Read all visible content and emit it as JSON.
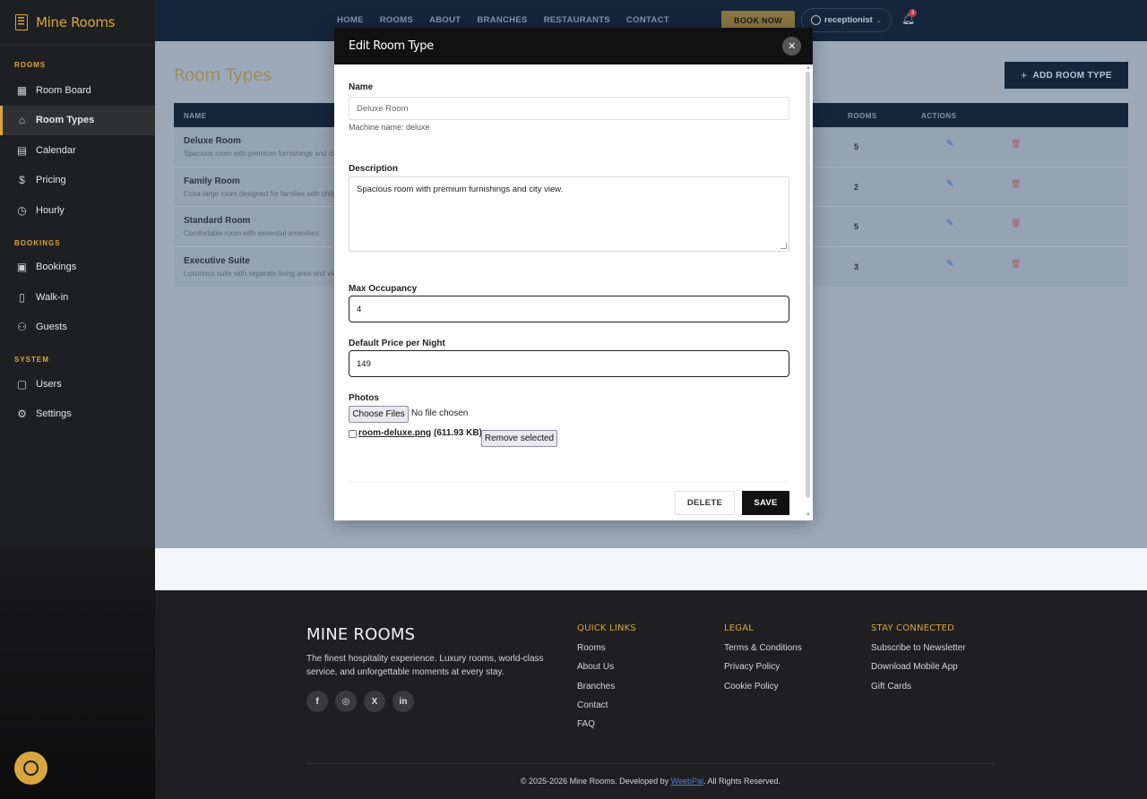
{
  "brand": {
    "name": "Mine Rooms"
  },
  "sidebar": {
    "sections": [
      {
        "title": "ROOMS",
        "items": [
          {
            "label": "Room Board",
            "icon": "grid-icon"
          },
          {
            "label": "Room Types",
            "icon": "home-icon",
            "active": true
          },
          {
            "label": "Calendar",
            "icon": "calendar-icon"
          },
          {
            "label": "Pricing",
            "icon": "dollar-icon"
          },
          {
            "label": "Hourly",
            "icon": "clock-icon"
          }
        ]
      },
      {
        "title": "BOOKINGS",
        "items": [
          {
            "label": "Bookings",
            "icon": "clipboard-icon"
          },
          {
            "label": "Walk-in",
            "icon": "door-icon"
          },
          {
            "label": "Guests",
            "icon": "users-icon"
          }
        ]
      },
      {
        "title": "SYSTEM",
        "items": [
          {
            "label": "Users",
            "icon": "id-card-icon"
          },
          {
            "label": "Settings",
            "icon": "gear-icon"
          }
        ]
      }
    ]
  },
  "topnav": {
    "links": [
      "HOME",
      "ROOMS",
      "ABOUT",
      "BRANCHES",
      "RESTAURANTS",
      "CONTACT"
    ],
    "book_now": "BOOK NOW",
    "user": "receptionist",
    "notifications": "3"
  },
  "page": {
    "title": "Room Types",
    "add_button": "ADD ROOM TYPE",
    "columns": {
      "name": "NAME",
      "rooms": "ROOMS",
      "actions": "ACTIONS"
    },
    "rows": [
      {
        "name": "Deluxe Room",
        "desc": "Spacious room with premium furnishings and city view.",
        "rooms": "5"
      },
      {
        "name": "Family Room",
        "desc": "Extra-large room designed for families with children.",
        "rooms": "2"
      },
      {
        "name": "Standard Room",
        "desc": "Comfortable room with essential amenities.",
        "rooms": "5"
      },
      {
        "name": "Executive Suite",
        "desc": "Luxurious suite with separate living area and views.",
        "rooms": "3"
      }
    ]
  },
  "modal": {
    "title": "Edit Room Type",
    "name_label": "Name",
    "name_value": "Deluxe Room",
    "machine_name": "Machine name: deluxe",
    "description_label": "Description",
    "description_value": "Spacious room with premium furnishings and city view.",
    "max_occupancy_label": "Max Occupancy",
    "max_occupancy_value": "4",
    "price_label": "Default Price per Night",
    "price_value": "149",
    "photos_label": "Photos",
    "choose_files": "Choose Files",
    "no_file": "No file chosen",
    "file_name": "room-deluxe.png",
    "file_size": "(611.93 KB)",
    "remove_selected": "Remove selected",
    "delete_label": "DELETE",
    "save_label": "SAVE"
  },
  "footer": {
    "brand": "MINE ROOMS",
    "desc": "The finest hospitality experience. Luxury rooms, world-class service, and unforgettable moments at every stay.",
    "columns": [
      {
        "title": "QUICK LINKS",
        "links": [
          "Rooms",
          "About Us",
          "Branches",
          "Contact",
          "FAQ"
        ]
      },
      {
        "title": "LEGAL",
        "links": [
          "Terms & Conditions",
          "Privacy Policy",
          "Cookie Policy"
        ]
      },
      {
        "title": "STAY CONNECTED",
        "links": [
          "Subscribe to Newsletter",
          "Download Mobile App",
          "Gift Cards"
        ]
      }
    ],
    "copyright_pre": "© 2025-2026 Mine Rooms. Developed by ",
    "copyright_link": "WeebPal",
    "copyright_post": ". All Rights Reserved."
  },
  "colors": {
    "accent": "#d9a63f",
    "navy": "#15263b",
    "dark": "#1e1f22"
  }
}
